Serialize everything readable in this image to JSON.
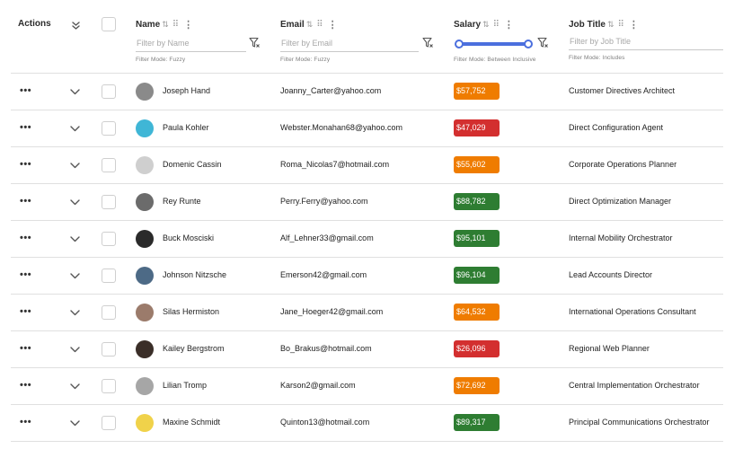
{
  "header": {
    "actions_label": "Actions",
    "name": {
      "label": "Name",
      "placeholder": "Filter by Name",
      "filter_mode": "Filter Mode: Fuzzy"
    },
    "email": {
      "label": "Email",
      "placeholder": "Filter by Email",
      "filter_mode": "Filter Mode: Fuzzy"
    },
    "salary": {
      "label": "Salary",
      "filter_mode": "Filter Mode: Between Inclusive",
      "range_min_fraction": 0,
      "range_max_fraction": 1
    },
    "job_title": {
      "label": "Job Title",
      "placeholder": "Filter by Job Title",
      "filter_mode": "Filter Mode: Includes"
    }
  },
  "icons": {
    "sort": "sort-arrows-icon",
    "drag": "drag-handle-icon",
    "menu": "column-menu-icon",
    "filter": "filter-clear-icon",
    "expand_all": "double-chevron-down-icon",
    "row_expand": "chevron-down-icon",
    "row_actions": "more-horizontal-icon"
  },
  "colors": {
    "salary_low": "#d32f2f",
    "salary_mid": "#ef7c00",
    "salary_high": "#2e7d32",
    "slider": "#4b6fde"
  },
  "rows": [
    {
      "name": "Joseph Hand",
      "email": "Joanny_Carter@yahoo.com",
      "salary": "$57,752",
      "salary_level": "mid",
      "job_title": "Customer Directives Architect",
      "avatar_color": "#8a8a8a"
    },
    {
      "name": "Paula Kohler",
      "email": "Webster.Monahan68@yahoo.com",
      "salary": "$47,029",
      "salary_level": "low",
      "job_title": "Direct Configuration Agent",
      "avatar_color": "#3fb6d6"
    },
    {
      "name": "Domenic Cassin",
      "email": "Roma_Nicolas7@hotmail.com",
      "salary": "$55,602",
      "salary_level": "mid",
      "job_title": "Corporate Operations Planner",
      "avatar_color": "#cfcfcf"
    },
    {
      "name": "Rey Runte",
      "email": "Perry.Ferry@yahoo.com",
      "salary": "$88,782",
      "salary_level": "high",
      "job_title": "Direct Optimization Manager",
      "avatar_color": "#6b6b6b"
    },
    {
      "name": "Buck Mosciski",
      "email": "Alf_Lehner33@gmail.com",
      "salary": "$95,101",
      "salary_level": "high",
      "job_title": "Internal Mobility Orchestrator",
      "avatar_color": "#2a2a2a"
    },
    {
      "name": "Johnson Nitzsche",
      "email": "Emerson42@gmail.com",
      "salary": "$96,104",
      "salary_level": "high",
      "job_title": "Lead Accounts Director",
      "avatar_color": "#4d6a86"
    },
    {
      "name": "Silas Hermiston",
      "email": "Jane_Hoeger42@gmail.com",
      "salary": "$64,532",
      "salary_level": "mid",
      "job_title": "International Operations Consultant",
      "avatar_color": "#9b7b6b"
    },
    {
      "name": "Kailey Bergstrom",
      "email": "Bo_Brakus@hotmail.com",
      "salary": "$26,096",
      "salary_level": "low",
      "job_title": "Regional Web Planner",
      "avatar_color": "#3a2e28"
    },
    {
      "name": "Lilian Tromp",
      "email": "Karson2@gmail.com",
      "salary": "$72,692",
      "salary_level": "mid",
      "job_title": "Central Implementation Orchestrator",
      "avatar_color": "#a6a6a6"
    },
    {
      "name": "Maxine Schmidt",
      "email": "Quinton13@hotmail.com",
      "salary": "$89,317",
      "salary_level": "high",
      "job_title": "Principal Communications Orchestrator",
      "avatar_color": "#f0d24a"
    }
  ]
}
